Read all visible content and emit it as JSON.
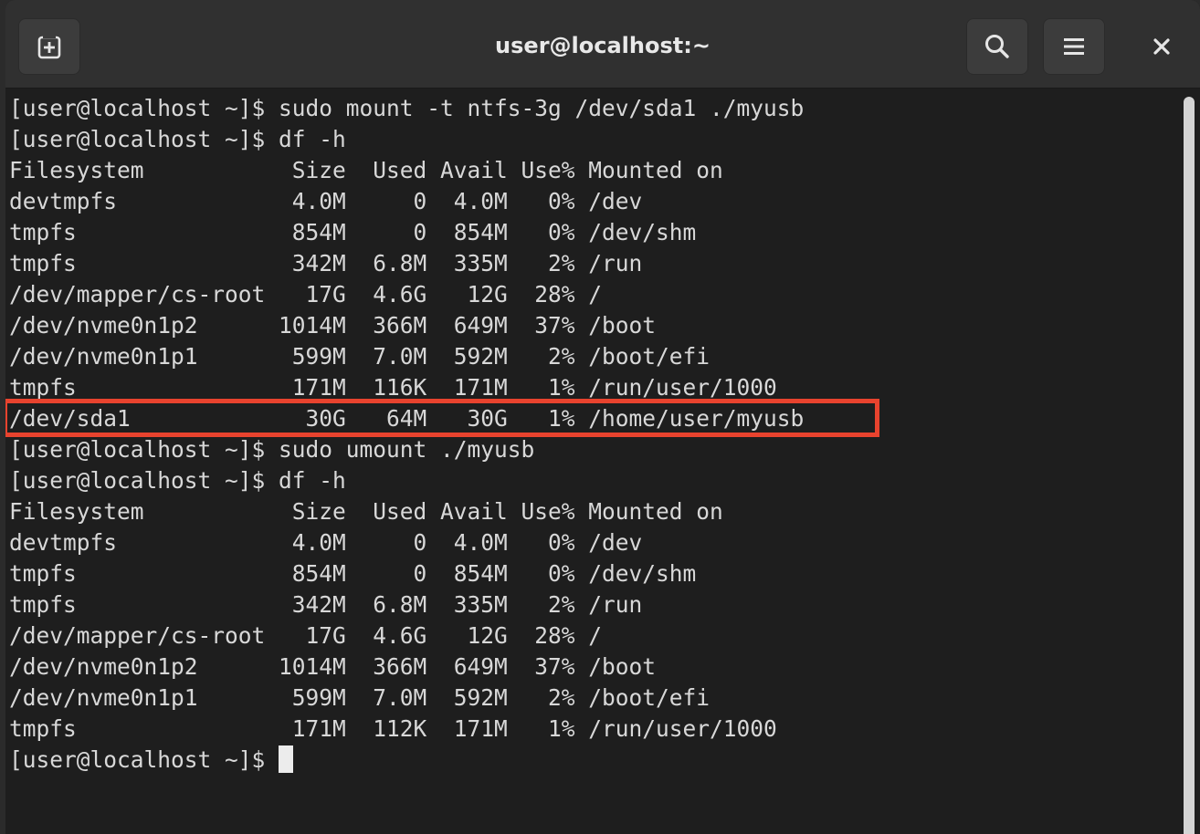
{
  "window": {
    "title": "user@localhost:~",
    "icons": {
      "new_tab": "new-tab-icon",
      "search": "search-icon",
      "menu": "hamburger-menu-icon",
      "close": "close-icon"
    }
  },
  "terminal": {
    "lines": [
      "[user@localhost ~]$ sudo mount -t ntfs-3g /dev/sda1 ./myusb",
      "[user@localhost ~]$ df -h",
      "Filesystem           Size  Used Avail Use% Mounted on",
      "devtmpfs             4.0M     0  4.0M   0% /dev",
      "tmpfs                854M     0  854M   0% /dev/shm",
      "tmpfs                342M  6.8M  335M   2% /run",
      "/dev/mapper/cs-root   17G  4.6G   12G  28% /",
      "/dev/nvme0n1p2      1014M  366M  649M  37% /boot",
      "/dev/nvme0n1p1       599M  7.0M  592M   2% /boot/efi",
      "tmpfs                171M  116K  171M   1% /run/user/1000",
      "/dev/sda1             30G   64M   30G   1% /home/user/myusb",
      "[user@localhost ~]$ sudo umount ./myusb",
      "[user@localhost ~]$ df -h",
      "Filesystem           Size  Used Avail Use% Mounted on",
      "devtmpfs             4.0M     0  4.0M   0% /dev",
      "tmpfs                854M     0  854M   0% /dev/shm",
      "tmpfs                342M  6.8M  335M   2% /run",
      "/dev/mapper/cs-root   17G  4.6G   12G  28% /",
      "/dev/nvme0n1p2      1014M  366M  649M  37% /boot",
      "/dev/nvme0n1p1       599M  7.0M  592M   2% /boot/efi",
      "tmpfs                171M  112K  171M   1% /run/user/1000",
      "[user@localhost ~]$ "
    ],
    "highlighted_line_index": 10,
    "highlight_color": "#e8432e",
    "background_color": "#1e1e1e",
    "text_color": "#d8d8d8"
  }
}
